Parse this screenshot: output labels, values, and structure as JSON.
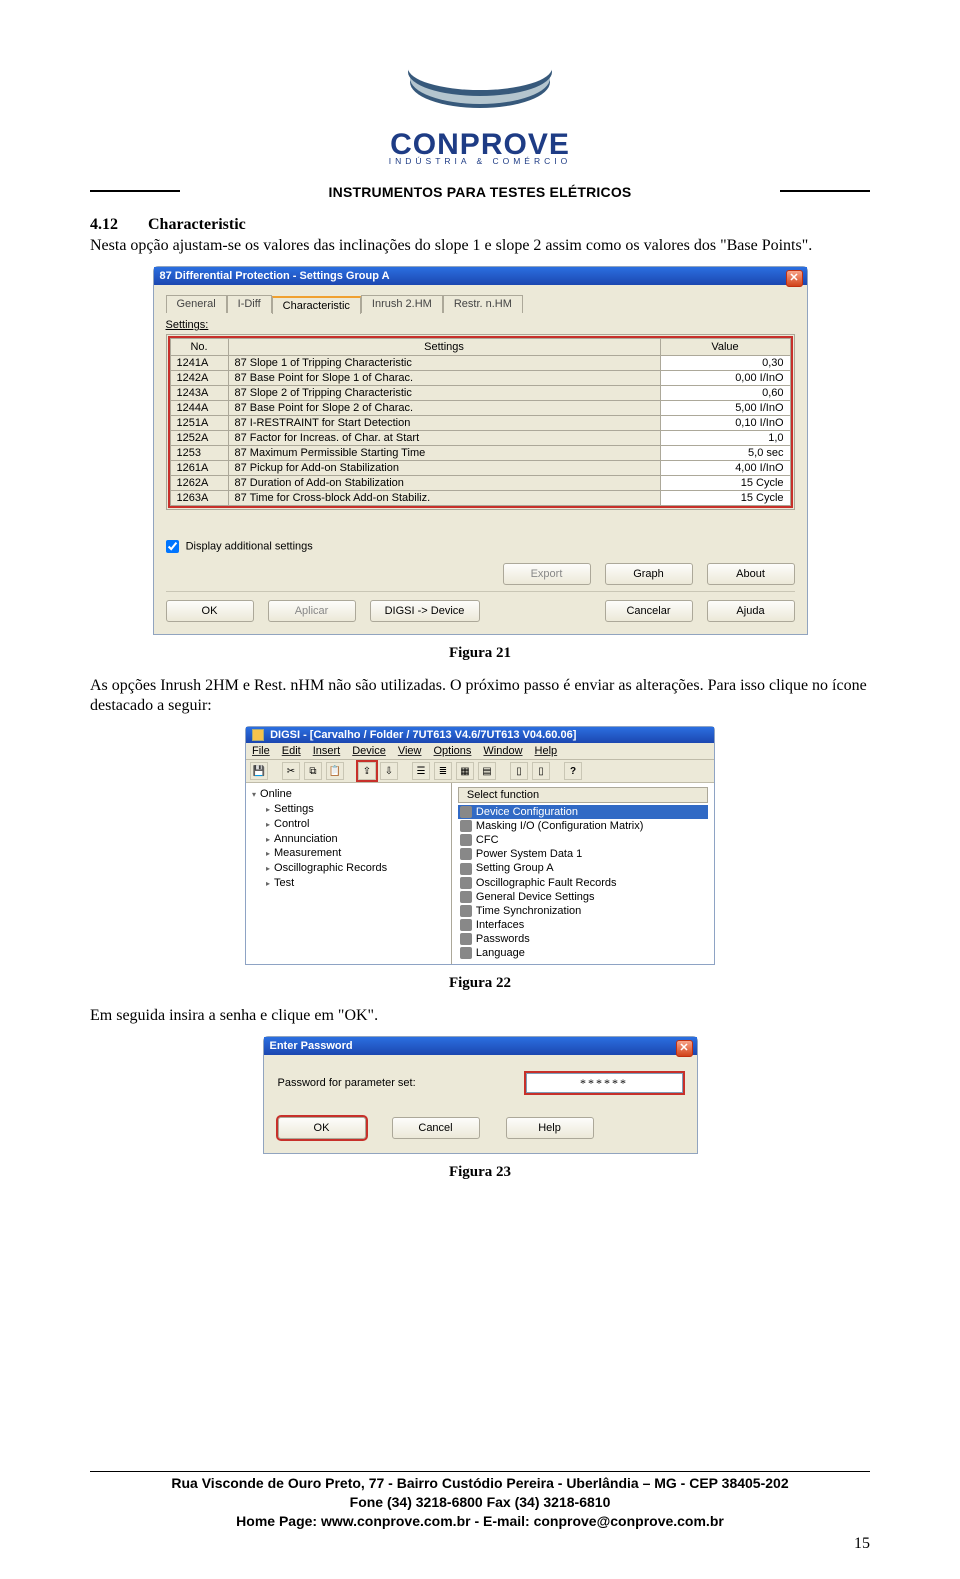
{
  "header": {
    "company": "CONPROVE",
    "subtitle": "INDÚSTRIA & COMÉRCIO",
    "banner": "INSTRUMENTOS PARA TESTES ELÉTRICOS"
  },
  "section": {
    "number": "4.12",
    "title": "Characteristic",
    "text": "Nesta opção ajustam-se os valores das inclinações do slope 1 e slope 2 assim como os valores dos \"Base Points\"."
  },
  "dialog1": {
    "title": "87 Differential Protection - Settings Group A",
    "tabs": [
      "General",
      "I-Diff",
      "Characteristic",
      "Inrush 2.HM",
      "Restr. n.HM"
    ],
    "active_tab": "Characteristic",
    "settings_label": "Settings:",
    "columns": [
      "No.",
      "Settings",
      "Value"
    ],
    "rows": [
      {
        "no": "1241A",
        "set": "87 Slope 1 of Tripping Characteristic",
        "val": "0,30"
      },
      {
        "no": "1242A",
        "set": "87 Base Point for Slope 1 of Charac.",
        "val": "0,00 I/InO"
      },
      {
        "no": "1243A",
        "set": "87 Slope 2 of Tripping Characteristic",
        "val": "0,60"
      },
      {
        "no": "1244A",
        "set": "87 Base Point for Slope 2 of Charac.",
        "val": "5,00 I/InO"
      },
      {
        "no": "1251A",
        "set": "87 I-RESTRAINT for Start Detection",
        "val": "0,10 I/InO"
      },
      {
        "no": "1252A",
        "set": "87 Factor for Increas. of Char. at Start",
        "val": "1,0"
      },
      {
        "no": "1253",
        "set": "87 Maximum Permissible Starting Time",
        "val": "5,0 sec"
      },
      {
        "no": "1261A",
        "set": "87 Pickup for Add-on Stabilization",
        "val": "4,00 I/InO"
      },
      {
        "no": "1262A",
        "set": "87 Duration of Add-on Stabilization",
        "val": "15 Cycle"
      },
      {
        "no": "1263A",
        "set": "87 Time for Cross-block Add-on Stabiliz.",
        "val": "15 Cycle"
      }
    ],
    "checkbox": "Display additional settings",
    "btns_top": {
      "export": "Export",
      "graph": "Graph",
      "about": "About"
    },
    "btns_bottom": {
      "ok": "OK",
      "aplicar": "Aplicar",
      "digsi": "DIGSI -> Device",
      "cancelar": "Cancelar",
      "ajuda": "Ajuda"
    }
  },
  "fig21": "Figura 21",
  "mid_text_1": "As opções Inrush 2HM e Rest. nHM não são utilizadas.  O próximo passo é enviar as alterações. Para isso clique no ícone destacado a seguir:",
  "digsi": {
    "title": "DIGSI - [Carvalho / Folder / 7UT613 V4.6/7UT613 V04.60.06]",
    "menu": [
      "File",
      "Edit",
      "Insert",
      "Device",
      "View",
      "Options",
      "Window",
      "Help"
    ],
    "tree": [
      {
        "lvl": 1,
        "label": "Online",
        "open": true
      },
      {
        "lvl": 2,
        "label": "Settings"
      },
      {
        "lvl": 2,
        "label": "Control"
      },
      {
        "lvl": 2,
        "label": "Annunciation"
      },
      {
        "lvl": 2,
        "label": "Measurement"
      },
      {
        "lvl": 2,
        "label": "Oscillographic Records"
      },
      {
        "lvl": 2,
        "label": "Test"
      }
    ],
    "list_header": "Select function",
    "list": [
      {
        "label": "Device Configuration",
        "selected": true
      },
      {
        "label": "Masking I/O (Configuration Matrix)"
      },
      {
        "label": "CFC"
      },
      {
        "label": "Power System Data 1"
      },
      {
        "label": "Setting Group A"
      },
      {
        "label": "Oscillographic Fault Records"
      },
      {
        "label": "General Device Settings"
      },
      {
        "label": "Time Synchronization"
      },
      {
        "label": "Interfaces"
      },
      {
        "label": "Passwords"
      },
      {
        "label": "Language"
      }
    ]
  },
  "fig22": "Figura 22",
  "mid_text_2": "Em seguida insira a senha e clique em \"OK\".",
  "pwdialog": {
    "title": "Enter Password",
    "label": "Password for parameter set:",
    "value": "******",
    "ok": "OK",
    "cancel": "Cancel",
    "help": "Help"
  },
  "fig23": "Figura 23",
  "footer": {
    "line1": "Rua Visconde de Ouro Preto, 77 -  Bairro Custódio Pereira - Uberlândia – MG -  CEP 38405-202",
    "line2": "Fone (34) 3218-6800          Fax (34) 3218-6810",
    "line3": "Home Page: www.conprove.com.br     -     E-mail: conprove@conprove.com.br",
    "page": "15"
  }
}
